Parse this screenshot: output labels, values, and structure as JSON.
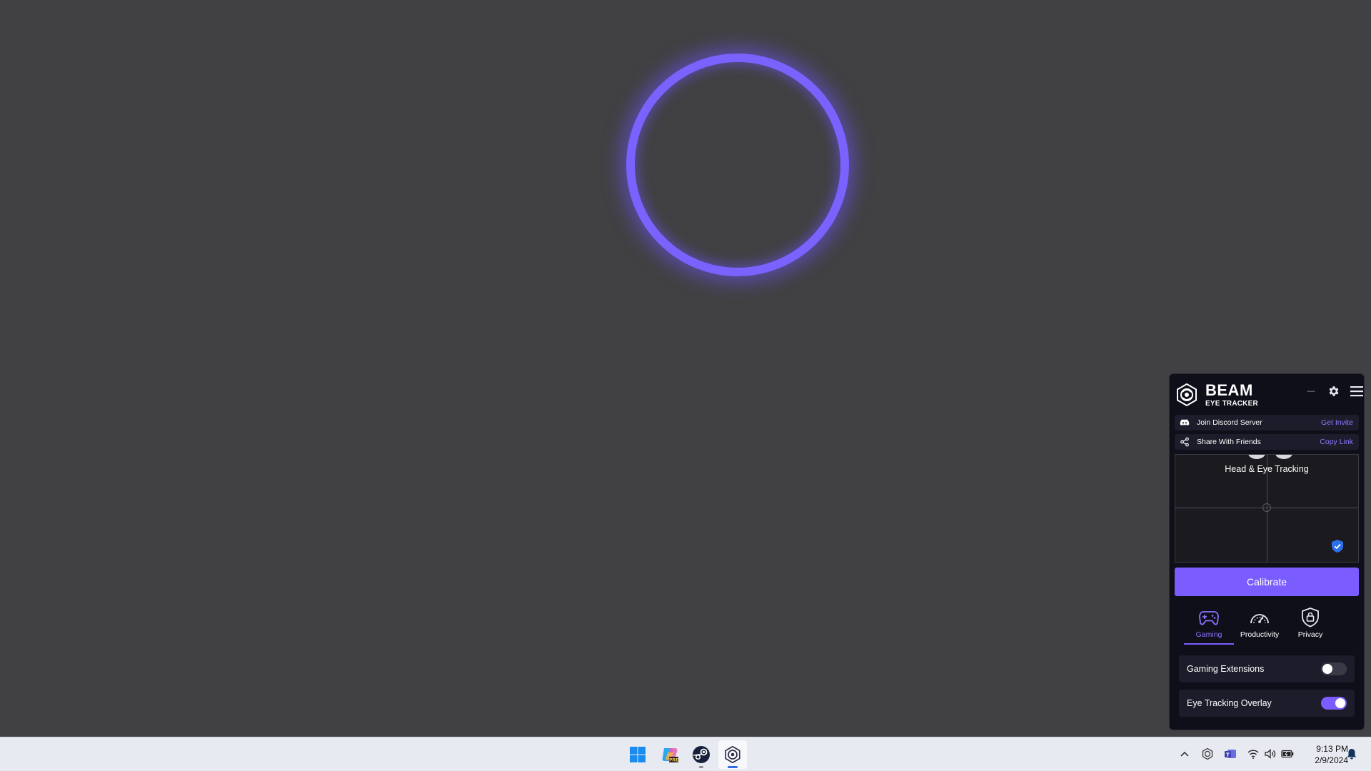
{
  "app": {
    "name": "BEAM",
    "subtitle": "EYE TRACKER",
    "minimize_glyph": "—",
    "accent_color": "#7a5cff"
  },
  "links": [
    {
      "label": "Join Discord Server",
      "action": "Get Invite",
      "icon": "discord-icon"
    },
    {
      "label": "Share With Friends",
      "action": "Copy Link",
      "icon": "share-icon"
    }
  ],
  "preview": {
    "mode_label": "Head & Eye Tracking"
  },
  "calibrate_label": "Calibrate",
  "tabs": [
    {
      "label": "Gaming",
      "icon": "gamepad-icon",
      "active": true
    },
    {
      "label": "Productivity",
      "icon": "speedometer-icon",
      "active": false
    },
    {
      "label": "Privacy",
      "icon": "shield-lock-icon",
      "active": false
    }
  ],
  "toggles": [
    {
      "label": "Gaming Extensions",
      "state": "off"
    },
    {
      "label": "Eye Tracking Overlay",
      "state": "on"
    }
  ],
  "taskbar": {
    "apps": [
      "windows-start-icon",
      "copilot-pre-icon",
      "steam-icon",
      "beam-eye-tracker-icon"
    ],
    "clock_time": "9:13 PM",
    "clock_date": "2/9/2024"
  }
}
